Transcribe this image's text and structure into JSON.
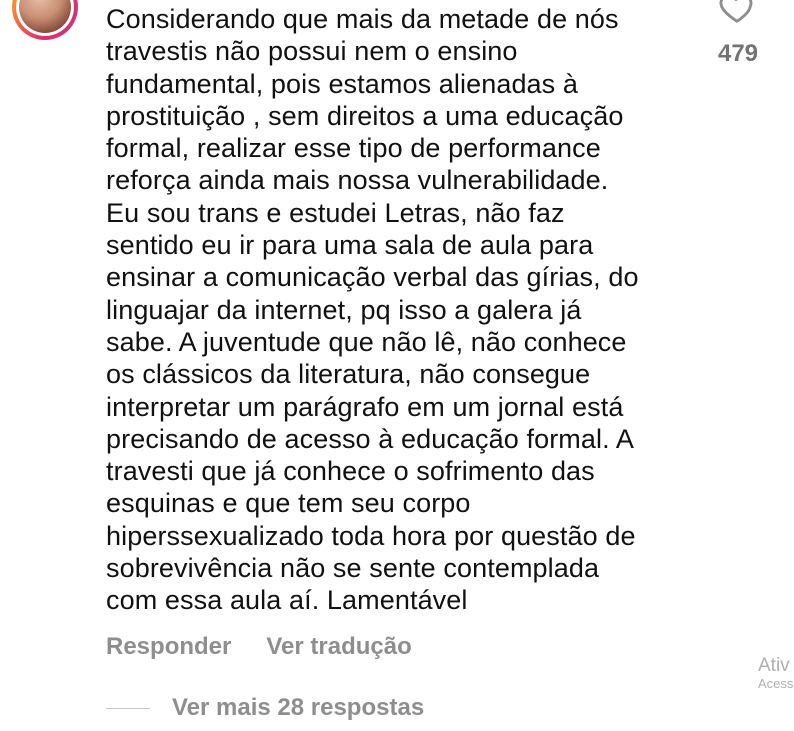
{
  "comment": {
    "text": "Considerando que mais da metade de nós\ntravestis não possui nem o ensino\nfundamental, pois estamos alienadas à\nprostituição , sem direitos a uma educação\nformal, realizar esse tipo de performance\nreforça ainda mais nossa vulnerabilidade.\nEu sou trans e estudei Letras, não faz\nsentido eu ir para uma sala de aula para\nensinar a comunicação verbal das gírias, do\nlinguajar da internet, pq isso a galera já\nsabe. A juventude que não lê, não conhece\nos clássicos da literatura, não consegue\ninterpretar um parágrafo em um jornal está\nprecisando de acesso à educação formal. A\ntravesti que já conhece o sofrimento das\nesquinas e que tem seu corpo\nhiperssexualizado toda hora por questão de\nsobrevivência não se sente contemplada\ncom essa aula aí. Lamentável",
    "like_count": "479",
    "like_icon": "heart-outline-icon"
  },
  "actions": {
    "reply_label": "Responder",
    "translate_label": "Ver tradução"
  },
  "replies": {
    "more_label": "Ver mais 28 respostas"
  },
  "watermark": {
    "title": "Ativ",
    "subtitle": "Acess"
  },
  "colors": {
    "text": "#111111",
    "muted": "#8e8e8e",
    "like_count": "#737373"
  }
}
